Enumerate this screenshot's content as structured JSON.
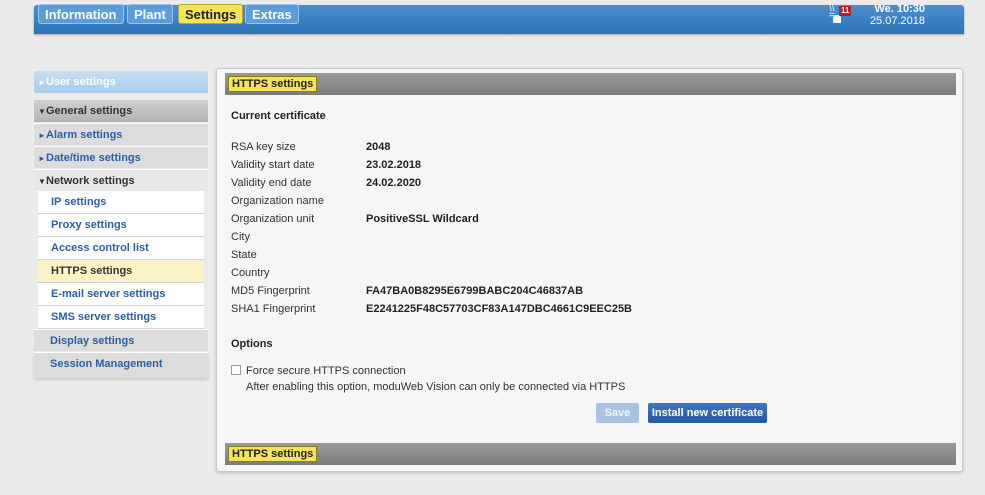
{
  "topnav": {
    "tabs": [
      "Information",
      "Plant",
      "Settings",
      "Extras"
    ],
    "active_tab": "Settings",
    "alarm_count": "11",
    "day_time": "We. 10:30",
    "date": "25.07.2018"
  },
  "sidebar": {
    "user_settings": "User settings",
    "general_settings": "General settings",
    "alarm_settings": "Alarm settings",
    "datetime_settings": "Date/time settings",
    "network_settings": "Network settings",
    "network_items": [
      "IP settings",
      "Proxy settings",
      "Access control list",
      "HTTPS settings",
      "E-mail server settings",
      "SMS server settings"
    ],
    "active_item": "HTTPS settings",
    "display_settings": "Display settings",
    "session_management": "Session Management"
  },
  "panel": {
    "title": "HTTPS settings",
    "current_certificate": "Current certificate",
    "rows": [
      {
        "label": "RSA key size",
        "value": "2048"
      },
      {
        "label": "Validity start date",
        "value": "23.02.2018"
      },
      {
        "label": "Validity end date",
        "value": "24.02.2020"
      },
      {
        "label": "Organization name",
        "value": ""
      },
      {
        "label": "Organization unit",
        "value": "PositiveSSL Wildcard"
      },
      {
        "label": "City",
        "value": ""
      },
      {
        "label": "State",
        "value": ""
      },
      {
        "label": "Country",
        "value": ""
      },
      {
        "label": "MD5 Fingerprint",
        "value": "FA47BA0B8295E6799BABC204C46837AB"
      },
      {
        "label": "SHA1 Fingerprint",
        "value": "E2241225F48C57703CF83A147DBC4661C9EEC25B"
      }
    ],
    "options_heading": "Options",
    "force_https_label": "Force secure HTTPS connection",
    "force_https_hint": "After enabling this option, moduWeb Vision can only be connected via HTTPS",
    "save_label": "Save",
    "install_label": "Install new certificate",
    "footer_title": "HTTPS settings"
  },
  "colors": {
    "accent_blue": "#2b73b8",
    "active_yellow": "#f5e45a",
    "link_blue": "#2b5fa3"
  }
}
